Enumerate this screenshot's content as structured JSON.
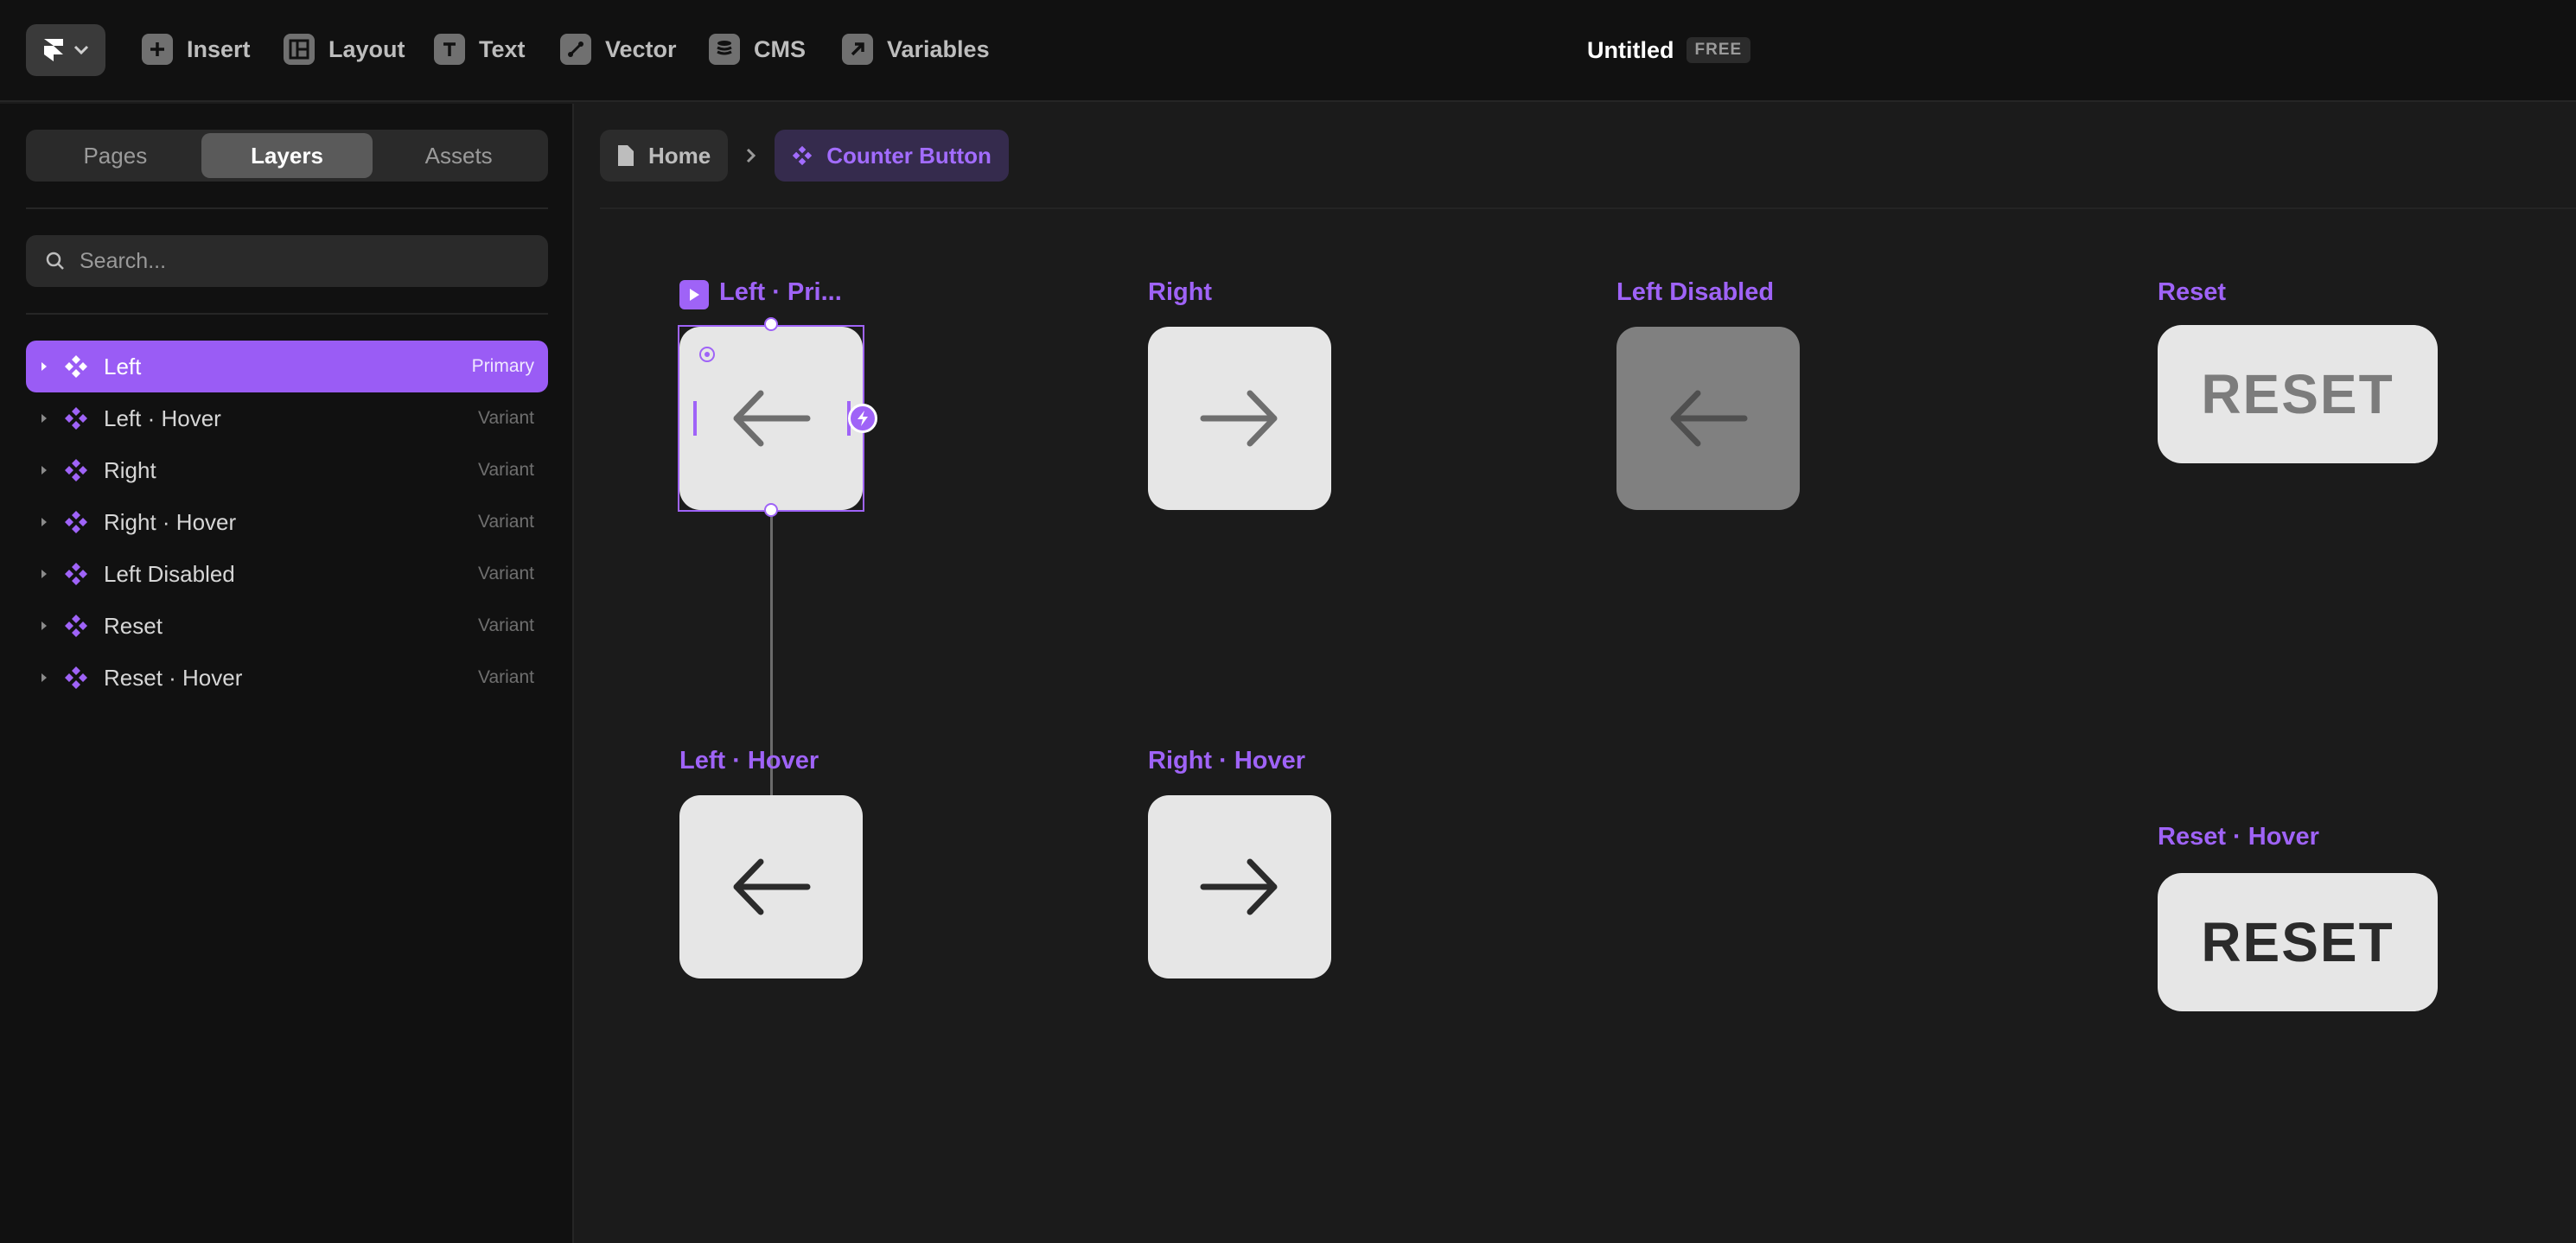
{
  "toolbar": {
    "items": [
      {
        "label": "Insert",
        "icon": "plus-icon"
      },
      {
        "label": "Layout",
        "icon": "layout-icon"
      },
      {
        "label": "Text",
        "icon": "text-icon"
      },
      {
        "label": "Vector",
        "icon": "pen-icon"
      },
      {
        "label": "CMS",
        "icon": "database-icon"
      },
      {
        "label": "Variables",
        "icon": "variables-icon"
      }
    ],
    "document_title": "Untitled",
    "plan_badge": "FREE"
  },
  "sidebar": {
    "tabs": [
      "Pages",
      "Layers",
      "Assets"
    ],
    "active_tab": "Layers",
    "search_placeholder": "Search...",
    "layers": [
      {
        "name": "Left",
        "type": "Primary",
        "active": true
      },
      {
        "name": "Left · Hover",
        "type": "Variant"
      },
      {
        "name": "Right",
        "type": "Variant"
      },
      {
        "name": "Right · Hover",
        "type": "Variant"
      },
      {
        "name": "Left Disabled",
        "type": "Variant"
      },
      {
        "name": "Reset",
        "type": "Variant"
      },
      {
        "name": "Reset · Hover",
        "type": "Variant"
      }
    ]
  },
  "canvas": {
    "breadcrumb": {
      "home": "Home",
      "current": "Counter Button"
    },
    "frames": {
      "left_primary": "Left · Pri...",
      "right": "Right",
      "left_disabled": "Left Disabled",
      "reset": "Reset",
      "left_hover": "Left · Hover",
      "right_hover": "Right · Hover",
      "reset_hover": "Reset · Hover"
    },
    "reset_text": "RESET"
  },
  "colors": {
    "accent": "#9f63f7",
    "selected_layer": "#9a5cf5",
    "card": "#e6e6e6",
    "card_disabled": "#808080"
  }
}
